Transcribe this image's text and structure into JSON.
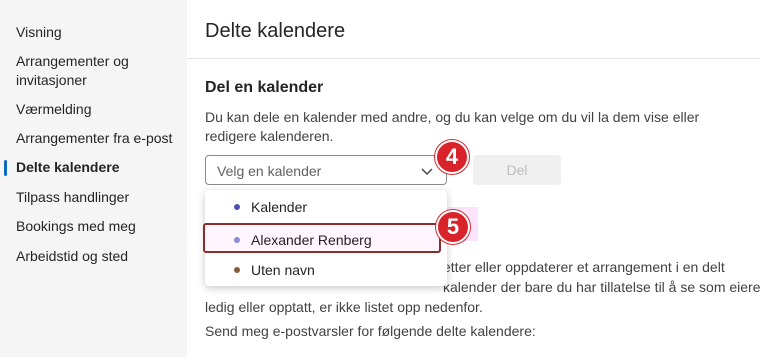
{
  "sidebar": {
    "items": [
      {
        "label": "Visning"
      },
      {
        "label": "Arrangementer og invitasjoner"
      },
      {
        "label": "Værmelding"
      },
      {
        "label": "Arrangementer fra e-post"
      },
      {
        "label": "Delte kalendere",
        "active": true
      },
      {
        "label": "Tilpass handlinger"
      },
      {
        "label": "Bookings med meg"
      },
      {
        "label": "Arbeidstid og sted"
      }
    ]
  },
  "page": {
    "title": "Delte kalendere",
    "section_title": "Del en kalender",
    "description": "Du kan dele en kalender med andre, og du kan velge om du vil la dem vise eller redigere kalenderen."
  },
  "dropdown": {
    "placeholder": "Velg en kalender",
    "chevron_icon": "chevron-down-icon",
    "options": [
      {
        "label": "Kalender",
        "dot_color": "#4f52b2"
      },
      {
        "label": "Alexander Renberg",
        "dot_color": "#8a8cd8"
      },
      {
        "label": "Uten navn",
        "dot_color": "#8b5a3c"
      }
    ]
  },
  "share_button": {
    "label": "Del"
  },
  "badges": {
    "step1": "4",
    "step2": "5",
    "color": "#d8232a"
  },
  "body": {
    "line1": "etter eller oppdaterer et arrangement i en delt",
    "line2": "kalender der bare du har tillatelse til å se som eieren er",
    "line3": "ledig eller opptatt, er ikke listet opp nedenfor.",
    "send_text": "Send meg e-postvarsler for følgende delte kalendere:"
  },
  "colors": {
    "accent": "#0f6cbd",
    "highlight_border": "#8b2d2a"
  }
}
